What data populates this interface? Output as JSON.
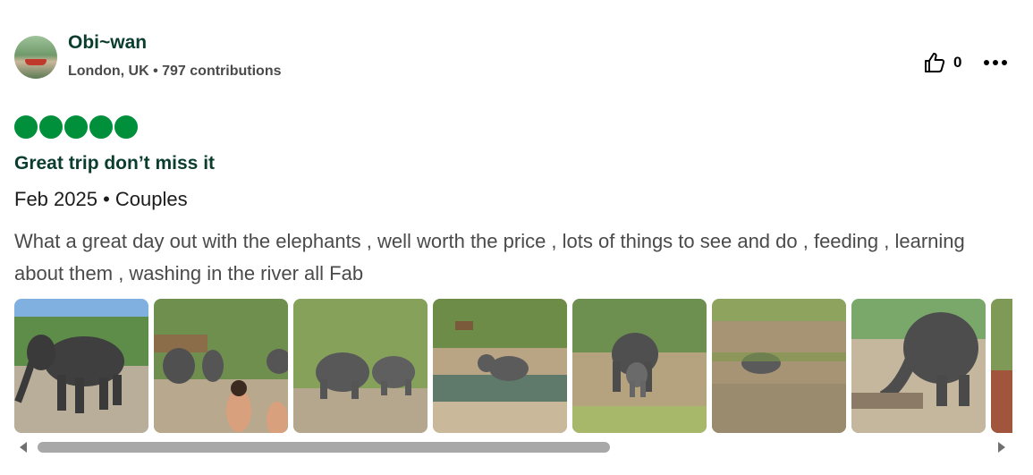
{
  "review": {
    "author": {
      "name": "Obi~wan",
      "location_line": "London, UK • 797 contributions",
      "avatar_icon": "avatar-photo"
    },
    "helpful": {
      "icon": "thumbs-up-icon",
      "count": "0"
    },
    "more_icon": "more-dots-icon",
    "rating": {
      "value": 5,
      "max": 5,
      "color": "#008f3b"
    },
    "title": "Great trip don’t miss it",
    "trip_line": "Feb 2025 • Couples",
    "text": "What a great day out with the elephants , well worth the price , lots of things to see and do , feeding , learning about them , washing in the river all Fab",
    "photos": [
      {
        "subject": "elephant-walking"
      },
      {
        "subject": "people-with-elephants"
      },
      {
        "subject": "elephants-in-camp"
      },
      {
        "subject": "elephants-in-river"
      },
      {
        "subject": "mother-and-baby-elephant"
      },
      {
        "subject": "elephant-lying-in-mud"
      },
      {
        "subject": "elephant-at-fence"
      },
      {
        "subject": "partial-photo"
      }
    ],
    "carousel": {
      "scroll_fraction": 0.6
    }
  }
}
